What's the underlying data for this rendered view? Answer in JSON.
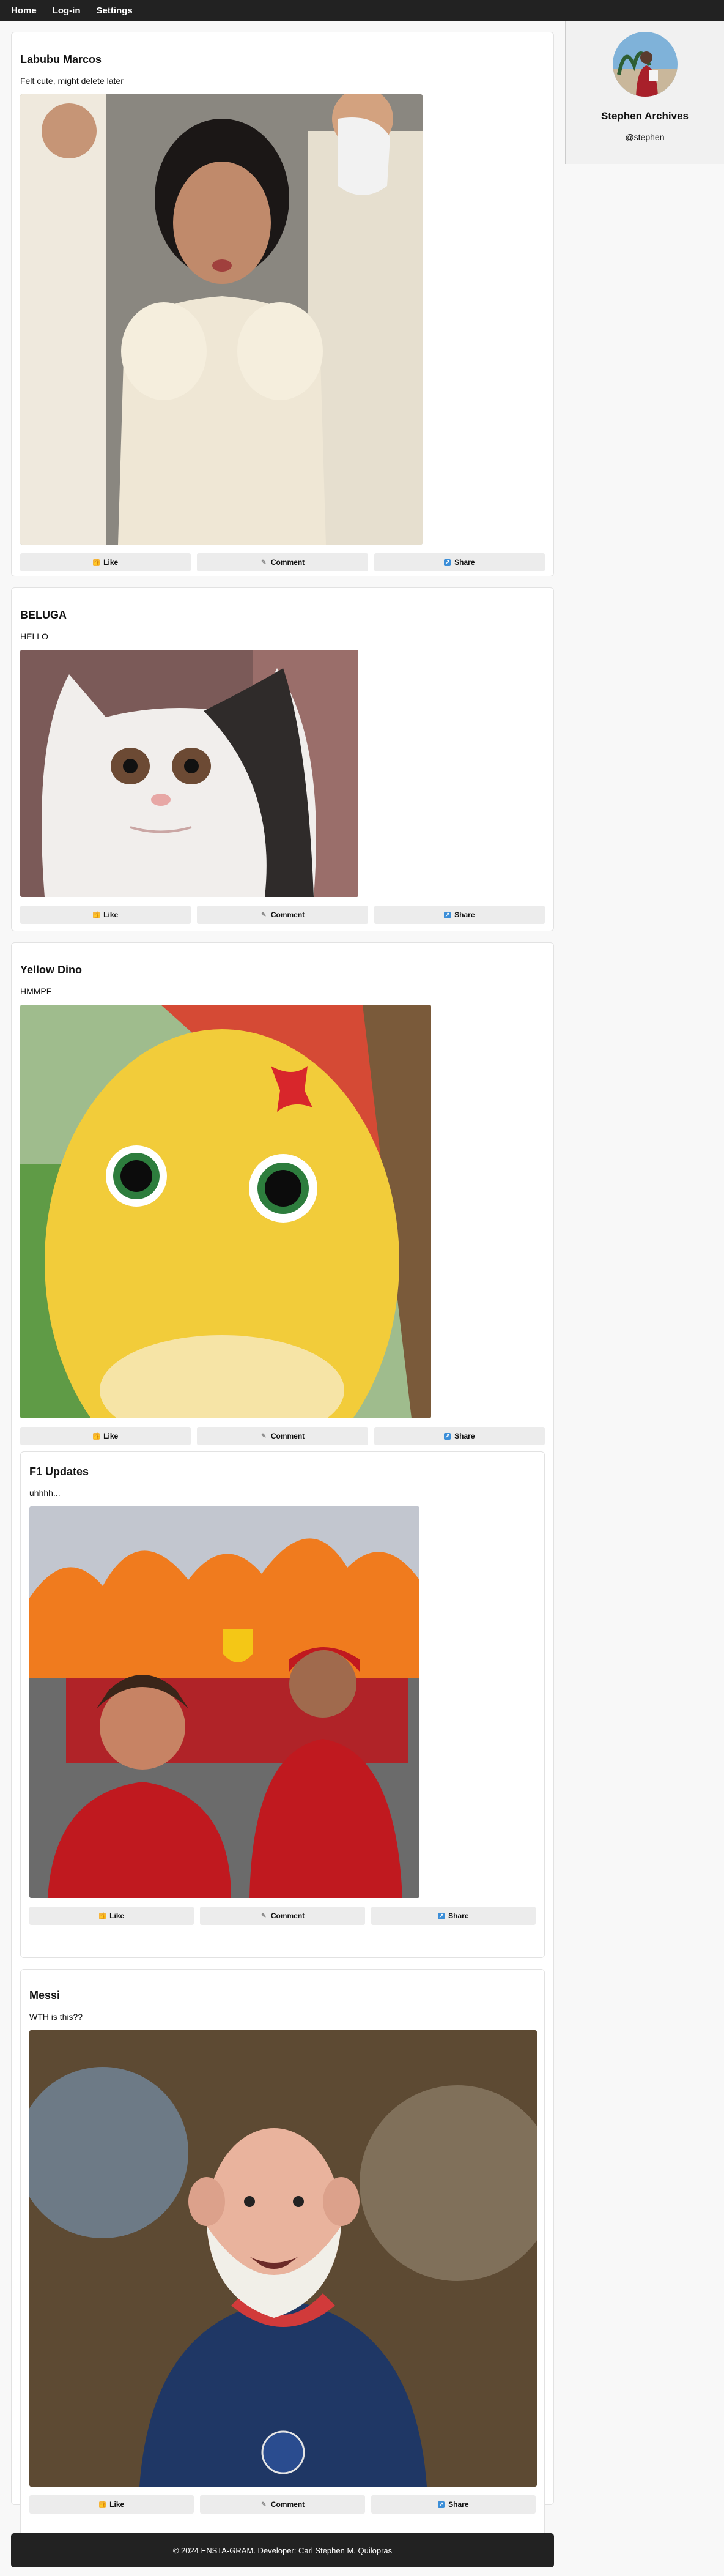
{
  "nav": {
    "home": "Home",
    "login": "Log-in",
    "settings": "Settings"
  },
  "profile": {
    "name": "Stephen Archives",
    "handle": "@stephen"
  },
  "actions": {
    "like": "Like",
    "comment": "Comment",
    "share": "Share"
  },
  "posts": [
    {
      "title": "Labubu Marcos",
      "caption": "Felt cute, might delete later"
    },
    {
      "title": "BELUGA",
      "caption": "HELLO"
    },
    {
      "title": "Yellow Dino",
      "caption": "HMMPF"
    },
    {
      "title": "F1 Updates",
      "caption": "uhhhh..."
    },
    {
      "title": "Messi",
      "caption": "WTH is this??"
    }
  ],
  "footer": {
    "text": "© 2024 ENSTA-GRAM. Developer: Carl Stephen M. Quilopras"
  }
}
